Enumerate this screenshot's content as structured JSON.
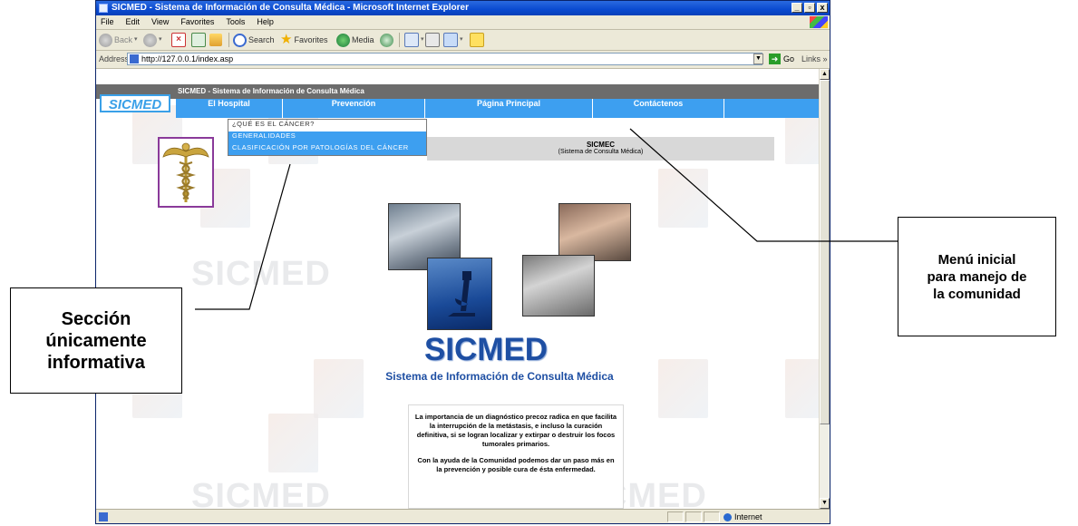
{
  "window": {
    "title": "SICMED - Sistema de Información de Consulta Médica - Microsoft Internet Explorer",
    "buttons": [
      "_",
      "▫",
      "x"
    ]
  },
  "menubar": [
    "File",
    "Edit",
    "View",
    "Favorites",
    "Tools",
    "Help"
  ],
  "toolbar": {
    "back": "Back",
    "search": "Search",
    "favorites": "Favorites",
    "media": "Media"
  },
  "address": {
    "label": "Address",
    "url": "http://127.0.0.1/index.asp",
    "go": "Go",
    "links": "Links »"
  },
  "site": {
    "logo": "SICMED",
    "header_text": "SICMED - Sistema de Información de Consulta Médica",
    "nav": [
      "El Hospital",
      "Prevención",
      "Página Principal",
      "Contáctenos"
    ],
    "dropdown": [
      "¿QUÉ ES EL CÁNCER?",
      "GENERALIDADES",
      "CLASIFICACIÓN POR PATOLOGÍAS DEL CÁNCER"
    ],
    "sicmec_title": "SICMEC",
    "sicmec_subtitle": "(Sistema de Consulta Médica)",
    "title": "SICMED",
    "subtitle": "Sistema de Información de Consulta Médica",
    "info_p1": "La importancia de un diagnóstico precoz radica en que facilita la interrupción de la metástasis, e incluso la curación definitiva, si se logran localizar y extirpar o destruir los focos tumorales primarios.",
    "info_p2": "Con la ayuda de la Comunidad podemos dar un paso más en la prevención y posible cura de ésta enfermedad."
  },
  "status": {
    "zone": "Internet"
  },
  "annotations": {
    "left": "Sección únicamente informativa",
    "right": "Menú inicial para manejo de la comunidad"
  }
}
